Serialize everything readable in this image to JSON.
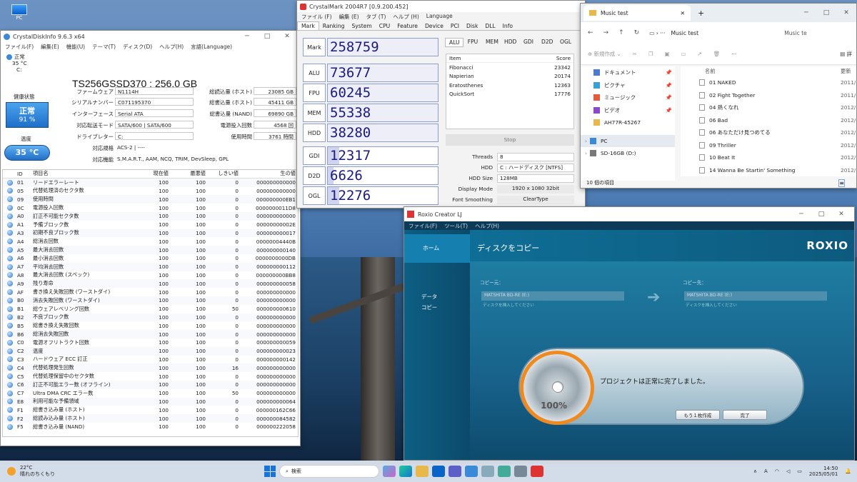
{
  "desktop": {
    "icon_label": "PC"
  },
  "cdi": {
    "title": "CrystalDiskInfo 9.6.3 x64",
    "menu": [
      "ファイル(F)",
      "編集(E)",
      "機能(U)",
      "テーマ(T)",
      "ディスク(D)",
      "ヘルプ(H)",
      "言語(Language)"
    ],
    "drive_tab": {
      "status": "正常",
      "temp": "35 °C",
      "letter": "C:"
    },
    "model": "TS256GSSD370 : 256.0 GB",
    "health_label": "健康状態",
    "health_status": "正常",
    "health_pct": "91 %",
    "temp_label": "温度",
    "temp_value": "35 °C",
    "left_labels": [
      "ファームウェア",
      "シリアルナンバー",
      "インターフェース",
      "対応転送モード",
      "ドライブレター",
      "対応規格",
      "対応機能"
    ],
    "left_values": [
      "N1114H",
      "C071195370",
      "Serial ATA",
      "SATA/600 | SATA/600",
      "C:",
      "ACS-2 | ----",
      "S.M.A.R.T., AAM, NCQ, TRIM, DevSleep, GPL"
    ],
    "right_labels": [
      "総読込量 (ホスト)",
      "総書込量 (ホスト)",
      "総書込量 (NAND)",
      "電源投入回数",
      "使用時間"
    ],
    "right_values": [
      "23085 GB",
      "45411 GB",
      "69890 GB",
      "4568 回",
      "3761 時間"
    ],
    "headers": [
      "ID",
      "項目名",
      "現在値",
      "最悪値",
      "しきい値",
      "生の値"
    ],
    "rows": [
      [
        "01",
        "リードエラーレート",
        "100",
        "100",
        "0",
        "000000000000"
      ],
      [
        "05",
        "代替処理済のセクタ数",
        "100",
        "100",
        "0",
        "000000000000"
      ],
      [
        "09",
        "使用時間",
        "100",
        "100",
        "0",
        "000000000EB1"
      ],
      [
        "0C",
        "電源投入回数",
        "100",
        "100",
        "0",
        "0000000011D8"
      ],
      [
        "A0",
        "訂正不可能セクタ数",
        "100",
        "100",
        "0",
        "000000000000"
      ],
      [
        "A1",
        "予備ブロック数",
        "100",
        "100",
        "0",
        "00000000002E"
      ],
      [
        "A3",
        "初期不良ブロック数",
        "100",
        "100",
        "0",
        "000000000017"
      ],
      [
        "A4",
        "総消去回数",
        "100",
        "100",
        "0",
        "00000004440B"
      ],
      [
        "A5",
        "最大消去回数",
        "100",
        "100",
        "0",
        "000000000140"
      ],
      [
        "A6",
        "最小消去回数",
        "100",
        "100",
        "0",
        "0000000000DB"
      ],
      [
        "A7",
        "平均消去回数",
        "100",
        "100",
        "0",
        "000000000112"
      ],
      [
        "A8",
        "最大消去回数 (スペック)",
        "100",
        "100",
        "0",
        "000000000BB8"
      ],
      [
        "A9",
        "残り寿命",
        "100",
        "100",
        "0",
        "000000000058"
      ],
      [
        "AF",
        "書き換え失敗回数 (ワーストダイ)",
        "100",
        "100",
        "0",
        "000000000000"
      ],
      [
        "B0",
        "消去失敗回数 (ワーストダイ)",
        "100",
        "100",
        "0",
        "000000000000"
      ],
      [
        "B1",
        "総ウェアレベリング回数",
        "100",
        "100",
        "50",
        "000000000610"
      ],
      [
        "B2",
        "不良ブロック数",
        "100",
        "100",
        "0",
        "000000000000"
      ],
      [
        "B5",
        "総書き換え失敗回数",
        "100",
        "100",
        "0",
        "000000000000"
      ],
      [
        "B6",
        "総消去失敗回数",
        "100",
        "100",
        "0",
        "000000000000"
      ],
      [
        "C0",
        "電源オフリトラクト回数",
        "100",
        "100",
        "0",
        "000000000059"
      ],
      [
        "C2",
        "温度",
        "100",
        "100",
        "0",
        "000000000023"
      ],
      [
        "C3",
        "ハードウェア ECC 訂正",
        "100",
        "100",
        "0",
        "000000000142"
      ],
      [
        "C4",
        "代替処理発生回数",
        "100",
        "100",
        "16",
        "000000000000"
      ],
      [
        "C5",
        "代替処理保留中のセクタ数",
        "100",
        "100",
        "0",
        "000000000000"
      ],
      [
        "C6",
        "訂正不可能エラー数 (オフライン)",
        "100",
        "100",
        "0",
        "000000000000"
      ],
      [
        "C7",
        "Ultra DMA CRC エラー数",
        "100",
        "100",
        "50",
        "000000000000"
      ],
      [
        "E8",
        "利用可能な予備領域",
        "100",
        "100",
        "0",
        "000000000064"
      ],
      [
        "F1",
        "総書き込み量 (ホスト)",
        "100",
        "100",
        "0",
        "000000162C66"
      ],
      [
        "F2",
        "総読み込み量 (ホスト)",
        "100",
        "100",
        "0",
        "000000084582"
      ],
      [
        "F5",
        "総書き込み量 (NAND)",
        "100",
        "100",
        "0",
        "000000222058"
      ]
    ]
  },
  "cm": {
    "title": "CrystalMark 2004R7 [0.9.200.452]",
    "menu": [
      "ファイル (F)",
      "編集 (E)",
      "タブ (T)",
      "ヘルプ (H)",
      "Language"
    ],
    "tabs": [
      "Mark",
      "Ranking",
      "System",
      "CPU",
      "Feature",
      "Device",
      "PCI",
      "Disk",
      "DLL",
      "Info"
    ],
    "subtabs": [
      "ALU",
      "FPU",
      "MEM",
      "HDD",
      "GDI",
      "D2D",
      "OGL"
    ],
    "labels": [
      "Mark",
      "ALU",
      "FPU",
      "MEM",
      "HDD",
      "GDI",
      "D2D",
      "OGL"
    ],
    "scores": [
      "258759",
      "73677",
      "60245",
      "55338",
      "38280",
      "12317",
      "6626",
      "12276"
    ],
    "stop_label": "Stop",
    "item_header": [
      "Item",
      "Score"
    ],
    "items": [
      [
        "Fibonacci",
        "23342"
      ],
      [
        "Napierian",
        "20174"
      ],
      [
        "Eratosthenes",
        "12363"
      ],
      [
        "QuickSort",
        "17776"
      ]
    ],
    "settings": [
      [
        "Threads",
        "8"
      ],
      [
        "HDD",
        "C : ハードディスク [NTFS]"
      ],
      [
        "HDD Size",
        "128MB"
      ],
      [
        "Display Mode",
        "1920 x 1080 32bit"
      ],
      [
        "Font Smoothing",
        "ClearType"
      ]
    ]
  },
  "chart_data": {
    "type": "bar",
    "title": "",
    "categories": [
      "ALU",
      "FPU",
      "MEM",
      "HDD",
      "GDI",
      "D2D",
      "OGL"
    ],
    "values": [
      73677,
      60245,
      55338,
      38280,
      12317,
      6626,
      12276
    ],
    "total": {
      "label": "Mark",
      "value": 258759
    },
    "sub_scores": {
      "categories": [
        "Fibonacci",
        "Napierian",
        "Eratosthenes",
        "QuickSort"
      ],
      "values": [
        23342,
        20174,
        12363,
        17776
      ]
    }
  },
  "explorer": {
    "tab_title": "Music test",
    "path": "Music test",
    "search": "Music te",
    "new_label": "新規作成",
    "sidebar": [
      "ドキュメント",
      "ピクチャ",
      "ミュージック",
      "ビデオ",
      "AH77R-45267",
      "PC",
      "SD-16GB (D:)"
    ],
    "col_name": "名前",
    "col_date": "更新",
    "files": [
      "01 NAKED",
      "02 Fight Together",
      "04 熱くなれ",
      "06 Bad",
      "06 あなただけ見つめてる",
      "09 Thriller",
      "10 Beat It",
      "14 Wanna Be Startin' Something"
    ],
    "dates": [
      "2011/",
      "2011/",
      "2012/",
      "2012/",
      "2012/",
      "2012/",
      "2012/",
      "2012/"
    ],
    "status": "10 個の項目"
  },
  "roxio": {
    "title": "Roxio Creator LJ",
    "menu": [
      "ファイル(F)",
      "ツール(T)",
      "ヘルプ(H)"
    ],
    "home": "ホーム",
    "data": "データ",
    "copy": "コピー",
    "header": "ディスクをコピー",
    "logo": "ROXIO",
    "src_label": "コピー元：",
    "dst_label": "コピー先：",
    "src_drive": "MATSHITA BD-RE (E:)",
    "dst_drive": "MATSHITA BD-RE (E:)",
    "src_sub": "ディスクを挿入してください",
    "dst_sub": "ディスクを挿入してください",
    "dialog_msg": "プロジェクトは正常に完了しました。",
    "progress": "100%",
    "progress_value": 1.0,
    "btn_again": "もう１枚作成",
    "btn_done": "完了"
  },
  "taskbar": {
    "weather_temp": "22°C",
    "weather_desc": "晴れのちくもり",
    "search": "検索",
    "time": "14:50",
    "date": "2025/05/01",
    "ime": "A"
  }
}
